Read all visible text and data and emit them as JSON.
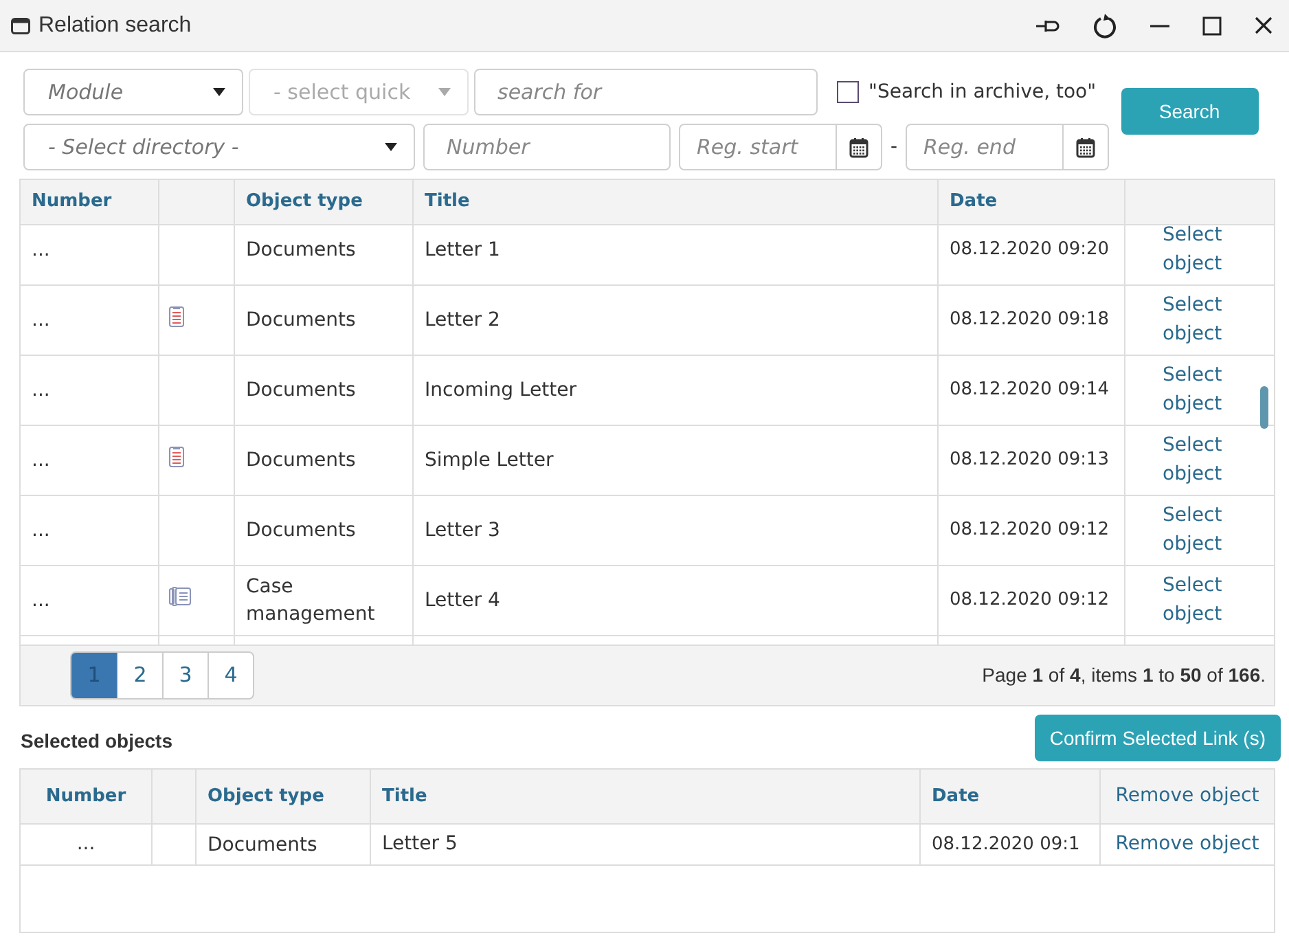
{
  "window": {
    "title": "Relation search"
  },
  "filters": {
    "module": {
      "placeholder": "Module"
    },
    "quick": {
      "placeholder": "- select quick",
      "disabled": true
    },
    "search": {
      "placeholder": "search for"
    },
    "archive": {
      "label": "\"Search in archive, too\"",
      "checked": false
    },
    "search_button": "Search",
    "directory": {
      "placeholder": "- Select directory -"
    },
    "number": {
      "placeholder": "Number"
    },
    "reg_start": {
      "placeholder": "Reg. start"
    },
    "range_separator": "-",
    "reg_end": {
      "placeholder": "Reg. end"
    }
  },
  "results": {
    "columns": [
      "Number",
      "Object type",
      "Title",
      "Date"
    ],
    "rows": [
      {
        "number": "...",
        "kind": "plain",
        "object_type": "Documents",
        "title": "Letter 1",
        "date": "08.12.2020 09:20",
        "action": "Select object"
      },
      {
        "number": "...",
        "kind": "document",
        "object_type": "Documents",
        "title": "Letter 2",
        "date": "08.12.2020 09:18",
        "action": "Select object"
      },
      {
        "number": "...",
        "kind": "plain",
        "object_type": "Documents",
        "title": "Incoming Letter",
        "date": "08.12.2020 09:14",
        "action": "Select object"
      },
      {
        "number": "...",
        "kind": "document",
        "object_type": "Documents",
        "title": "Simple Letter",
        "date": "08.12.2020 09:13",
        "action": "Select object"
      },
      {
        "number": "...",
        "kind": "plain",
        "object_type": "Documents",
        "title": "Letter 3",
        "date": "08.12.2020 09:12",
        "action": "Select object"
      },
      {
        "number": "...",
        "kind": "case",
        "object_type": "Case management",
        "title": "Letter 4",
        "date": "08.12.2020 09:12",
        "action": "Select object"
      }
    ],
    "pages": [
      {
        "label": "1",
        "selected": true
      },
      {
        "label": "2",
        "selected": false
      },
      {
        "label": "3",
        "selected": false
      },
      {
        "label": "4",
        "selected": false
      }
    ],
    "summary": "Page **1** of **4**, items **1** to **50** of **166**."
  },
  "selected": {
    "heading": "Selected objects",
    "confirm_button": "Confirm Selected Link (s)",
    "columns": [
      "Number",
      "Object type",
      "Title",
      "Date",
      "Remove object"
    ],
    "rows": [
      {
        "number": "...",
        "object_type": "Documents",
        "title": "Letter 5",
        "date": "08.12.2020 09:1",
        "action": "Remove object"
      }
    ]
  }
}
